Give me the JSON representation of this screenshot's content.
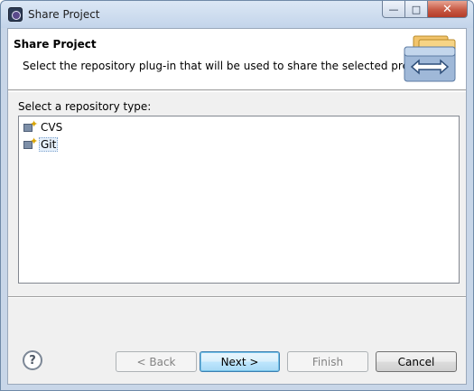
{
  "window": {
    "title": "Share Project"
  },
  "header": {
    "title": "Share Project",
    "description": "Select the repository plug-in that will be used to share the selected project."
  },
  "repository": {
    "label": "Select a repository type:",
    "items": [
      {
        "label": "CVS",
        "selected": false
      },
      {
        "label": "Git",
        "selected": true
      }
    ]
  },
  "buttons": {
    "back": "< Back",
    "next": "Next >",
    "finish": "Finish",
    "cancel": "Cancel",
    "help": "?"
  },
  "colors": {
    "accent": "#3c7fb1",
    "selection": "#e6f0fa"
  }
}
